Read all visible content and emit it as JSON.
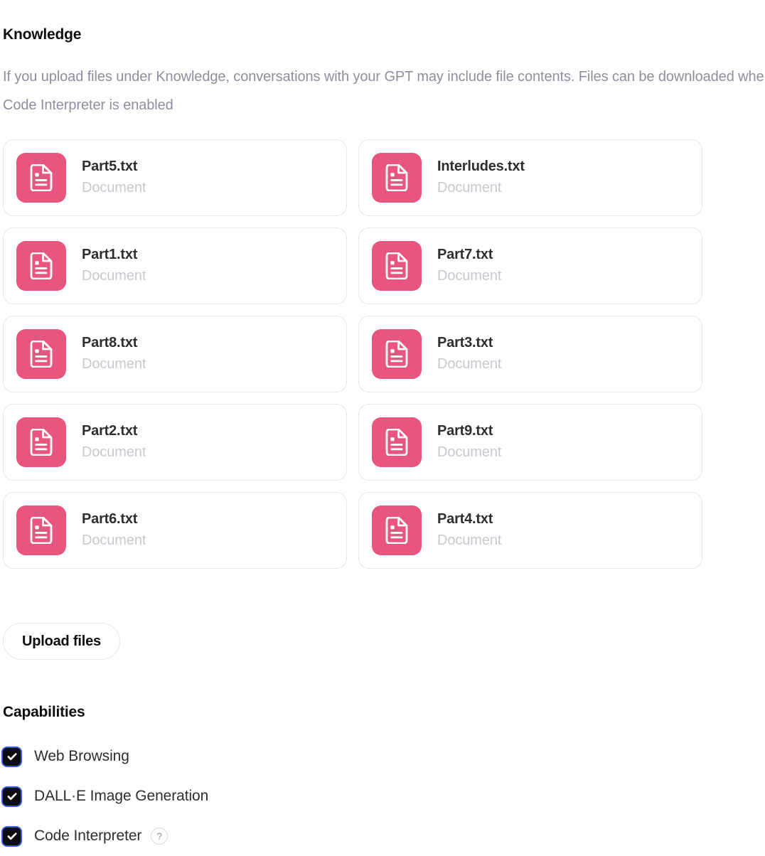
{
  "knowledge": {
    "title": "Knowledge",
    "description": "If you upload files under Knowledge, conversations with your GPT may include file contents. Files can be downloaded when Code Interpreter is enabled",
    "upload_button_label": "Upload files",
    "file_type_label": "Document",
    "file_icon_name": "document-file-icon",
    "icon_color": "#e8557f",
    "files": [
      {
        "name": "Part5.txt",
        "type": "Document"
      },
      {
        "name": "Interludes.txt",
        "type": "Document"
      },
      {
        "name": "Part1.txt",
        "type": "Document"
      },
      {
        "name": "Part7.txt",
        "type": "Document"
      },
      {
        "name": "Part8.txt",
        "type": "Document"
      },
      {
        "name": "Part3.txt",
        "type": "Document"
      },
      {
        "name": "Part2.txt",
        "type": "Document"
      },
      {
        "name": "Part9.txt",
        "type": "Document"
      },
      {
        "name": "Part6.txt",
        "type": "Document"
      },
      {
        "name": "Part4.txt",
        "type": "Document"
      }
    ]
  },
  "capabilities": {
    "title": "Capabilities",
    "items": [
      {
        "label": "Web Browsing",
        "checked": true,
        "help": false
      },
      {
        "label": "DALL·E Image Generation",
        "checked": true,
        "help": false
      },
      {
        "label": "Code Interpreter",
        "checked": true,
        "help": true,
        "help_glyph": "?"
      }
    ],
    "checkbox_color": "#0d0d0d",
    "focus_ring_color": "#3b5bdb",
    "check_glyph": "checkmark-icon"
  }
}
